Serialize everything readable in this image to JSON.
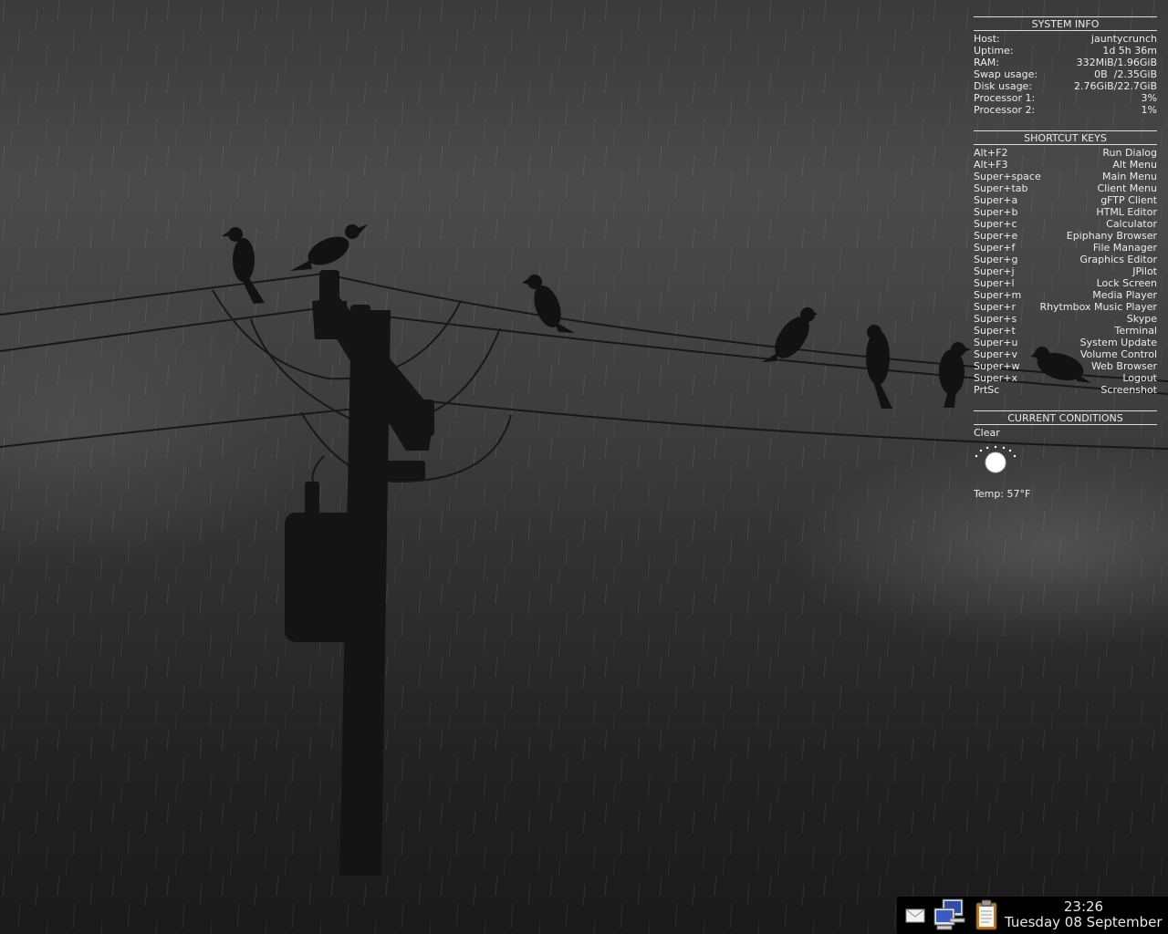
{
  "system_info": {
    "title": "SYSTEM INFO",
    "rows": [
      {
        "label": "Host:",
        "value": "jauntycrunch"
      },
      {
        "label": "Uptime:",
        "value": "1d 5h 36m"
      },
      {
        "label": "RAM:",
        "value": "332MiB/1.96GiB"
      },
      {
        "label": "Swap usage:",
        "value": "0B  /2.35GiB"
      },
      {
        "label": "Disk usage:",
        "value": "2.76GiB/22.7GiB"
      },
      {
        "label": "Processor 1:",
        "value": "3%"
      },
      {
        "label": "Processor 2:",
        "value": "1%"
      }
    ]
  },
  "shortcut_keys": {
    "title": "SHORTCUT KEYS",
    "rows": [
      {
        "key": "Alt+F2",
        "action": "Run Dialog"
      },
      {
        "key": "Alt+F3",
        "action": "Alt Menu"
      },
      {
        "key": "Super+space",
        "action": "Main Menu"
      },
      {
        "key": "Super+tab",
        "action": "Client Menu"
      },
      {
        "key": "Super+a",
        "action": "gFTP Client"
      },
      {
        "key": "Super+b",
        "action": "HTML Editor"
      },
      {
        "key": "Super+c",
        "action": "Calculator"
      },
      {
        "key": "Super+e",
        "action": "Epiphany Browser"
      },
      {
        "key": "Super+f",
        "action": "File Manager"
      },
      {
        "key": "Super+g",
        "action": "Graphics Editor"
      },
      {
        "key": "Super+j",
        "action": "JPilot"
      },
      {
        "key": "Super+l",
        "action": "Lock Screen"
      },
      {
        "key": "Super+m",
        "action": "Media Player"
      },
      {
        "key": "Super+r",
        "action": "Rhytmbox Music Player"
      },
      {
        "key": "Super+s",
        "action": "Skype"
      },
      {
        "key": "Super+t",
        "action": "Terminal"
      },
      {
        "key": "Super+u",
        "action": "System Update"
      },
      {
        "key": "Super+v",
        "action": "Volume Control"
      },
      {
        "key": "Super+w",
        "action": "Web Browser"
      },
      {
        "key": "Super+x",
        "action": "Logout"
      },
      {
        "key": "PrtSc",
        "action": "Screenshot"
      }
    ]
  },
  "current_conditions": {
    "title": "CURRENT CONDITIONS",
    "condition": "Clear",
    "icon": "clear-night-moon-icon",
    "temp": "Temp: 57°F"
  },
  "tray": {
    "icons": [
      "mail-icon",
      "network-computers-icon",
      "clipboard-icon"
    ]
  },
  "clock": {
    "time": "23:26",
    "date": "Tuesday 08 September"
  },
  "colors": {
    "text": "#ececec",
    "rule": "#dcdcdc",
    "tray_bg": "#000000"
  }
}
